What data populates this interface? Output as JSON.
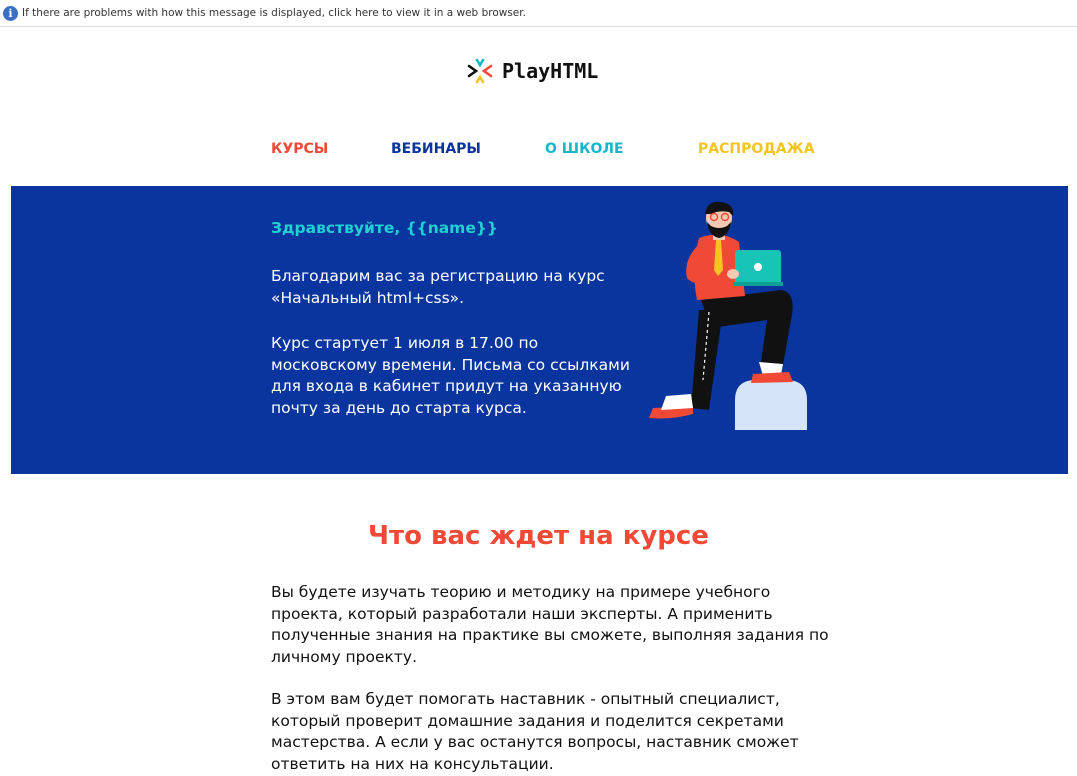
{
  "infobar": {
    "text": "If there are problems with how this message is displayed, click here to view it in a web browser."
  },
  "logo": {
    "name": "PlayHTML",
    "icon": "playhtml-logo-icon"
  },
  "nav": [
    {
      "label": "КУРСЫ",
      "color": "#f04a36"
    },
    {
      "label": "ВЕБИНАРЫ",
      "color": "#0a349e"
    },
    {
      "label": "О ШКОЛЕ",
      "color": "#17b6c9"
    },
    {
      "label": "РАСПРОДАЖА",
      "color": "#f5c422"
    }
  ],
  "hero": {
    "greeting": "Здравствуйте, {{name}}",
    "paragraph1": "Благодарим вас за регистрацию на курс «Начальный html+css».",
    "paragraph2": "Курс стартует 1 июля в 17.00 по московскому времени. Письма со ссылками для входа в кабинет придут на указанную почту за день до старта курса.",
    "illustration": "man-with-laptop-illustration"
  },
  "section": {
    "title": "Что вас ждет на курсе",
    "paragraph1": "Вы будете изучать теорию и методику на примере учебного проекта, который разработали наши эксперты. А применить полученные знания на практике вы сможете, выполняя задания по личному проекту.",
    "paragraph2": "В этом вам будет помогать наставник - опытный специалист, который проверит домашние задания и поделится секретами мастерства. А если у вас останутся вопросы, наставник сможет ответить на них на консультации."
  },
  "colors": {
    "hero_bg": "#0a349e",
    "accent_red": "#f04a36",
    "accent_cyan": "#1fd1d1"
  }
}
